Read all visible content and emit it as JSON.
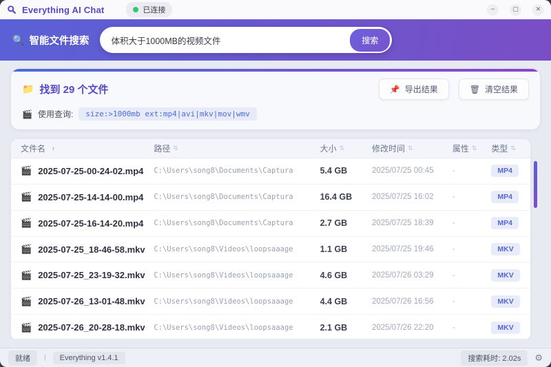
{
  "window": {
    "title": "Everything AI Chat",
    "connection_status": "已连接",
    "controls": {
      "minimize": "−",
      "maximize": "▢",
      "close": "✕"
    }
  },
  "search": {
    "label": "智能文件搜索",
    "query": "体积大于1000MB的视频文件",
    "button": "搜索"
  },
  "results": {
    "count_text": "找到 29 个文件",
    "query_label": "使用查询:",
    "query_code": "size:>1000mb ext:mp4|avi|mkv|mov|wmv",
    "export_button": "导出结果",
    "clear_button": "清空结果"
  },
  "table": {
    "columns": [
      {
        "label": "文件名",
        "sort_icon": "↑",
        "active": true
      },
      {
        "label": "路径",
        "sort_icon": "⇅",
        "active": false
      },
      {
        "label": "大小",
        "sort_icon": "⇅",
        "active": false
      },
      {
        "label": "修改时间",
        "sort_icon": "⇅",
        "active": false
      },
      {
        "label": "属性",
        "sort_icon": "⇅",
        "active": false
      },
      {
        "label": "类型",
        "sort_icon": "⇅",
        "active": false
      }
    ],
    "rows": [
      {
        "name": "2025-07-25-00-24-02.mp4",
        "path": "C:\\Users\\song8\\Documents\\Captura",
        "size": "5.4 GB",
        "modified": "2025/07/25 00:45",
        "attr": "-",
        "type": "MP4"
      },
      {
        "name": "2025-07-25-14-14-00.mp4",
        "path": "C:\\Users\\song8\\Documents\\Captura",
        "size": "16.4 GB",
        "modified": "2025/07/25 16:02",
        "attr": "-",
        "type": "MP4"
      },
      {
        "name": "2025-07-25-16-14-20.mp4",
        "path": "C:\\Users\\song8\\Documents\\Captura",
        "size": "2.7 GB",
        "modified": "2025/07/25 18:39",
        "attr": "-",
        "type": "MP4"
      },
      {
        "name": "2025-07-25_18-46-58.mkv",
        "path": "C:\\Users\\song8\\Videos\\loopsaaage",
        "size": "1.1 GB",
        "modified": "2025/07/25 19:46",
        "attr": "-",
        "type": "MKV"
      },
      {
        "name": "2025-07-25_23-19-32.mkv",
        "path": "C:\\Users\\song8\\Videos\\loopsaaage",
        "size": "4.6 GB",
        "modified": "2025/07/26 03:29",
        "attr": "-",
        "type": "MKV"
      },
      {
        "name": "2025-07-26_13-01-48.mkv",
        "path": "C:\\Users\\song8\\Videos\\loopsaaage",
        "size": "4.4 GB",
        "modified": "2025/07/26 16:56",
        "attr": "-",
        "type": "MKV"
      },
      {
        "name": "2025-07-26_20-28-18.mkv",
        "path": "C:\\Users\\song8\\Videos\\loopsaaage",
        "size": "2.1 GB",
        "modified": "2025/07/26 22:20",
        "attr": "-",
        "type": "MKV"
      }
    ]
  },
  "status_bar": {
    "state": "就绪",
    "divider": "|",
    "version": "Everything v1.4.1",
    "search_time": "搜索耗时: 2.02s"
  },
  "icons": {
    "search": "🔍",
    "folder": "📁",
    "clapper": "🎬",
    "file": "🎬",
    "export": "📌",
    "trash": "🗑",
    "gear": "⚙"
  },
  "colors": {
    "accent_start": "#5a61d6",
    "accent_end": "#7a4ec6",
    "brand_purple": "#5348c8",
    "connected_green": "#2ecc71",
    "badge_text": "#5668d0",
    "badge_bg": "#e8ebfa",
    "code_text": "#4d6fd8",
    "code_bg": "#e7eaf9"
  }
}
